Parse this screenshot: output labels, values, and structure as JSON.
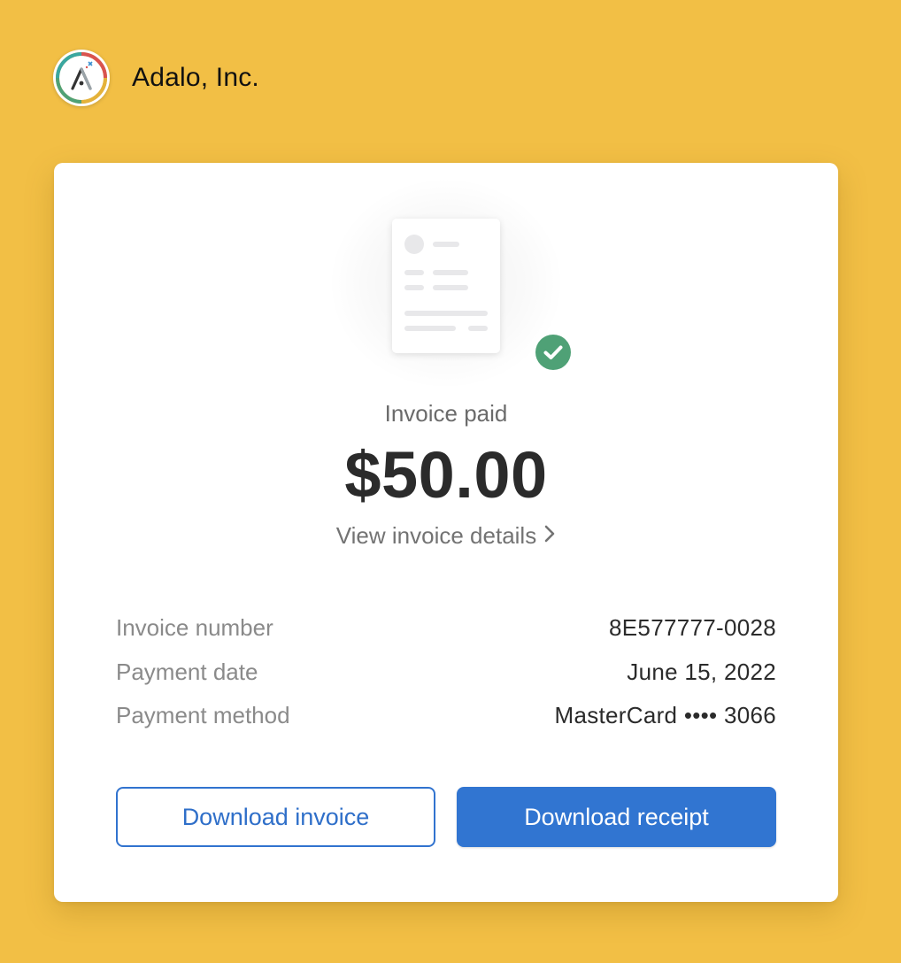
{
  "header": {
    "company_name": "Adalo, Inc."
  },
  "receipt": {
    "status_label": "Invoice paid",
    "amount": "$50.00",
    "view_details_label": "View invoice details"
  },
  "details": [
    {
      "label": "Invoice number",
      "value": "8E577777-0028"
    },
    {
      "label": "Payment date",
      "value": "June 15, 2022"
    },
    {
      "label": "Payment method",
      "value": "MasterCard •••• 3066"
    }
  ],
  "actions": {
    "download_invoice_label": "Download invoice",
    "download_receipt_label": "Download receipt"
  },
  "colors": {
    "background": "#f2bf45",
    "accent": "#3175d1",
    "success": "#4fa176"
  },
  "icons": {
    "logo": "adalo-logo-icon",
    "illustration": "invoice-document-icon",
    "status": "check-circle-icon",
    "link": "chevron-right-icon"
  }
}
